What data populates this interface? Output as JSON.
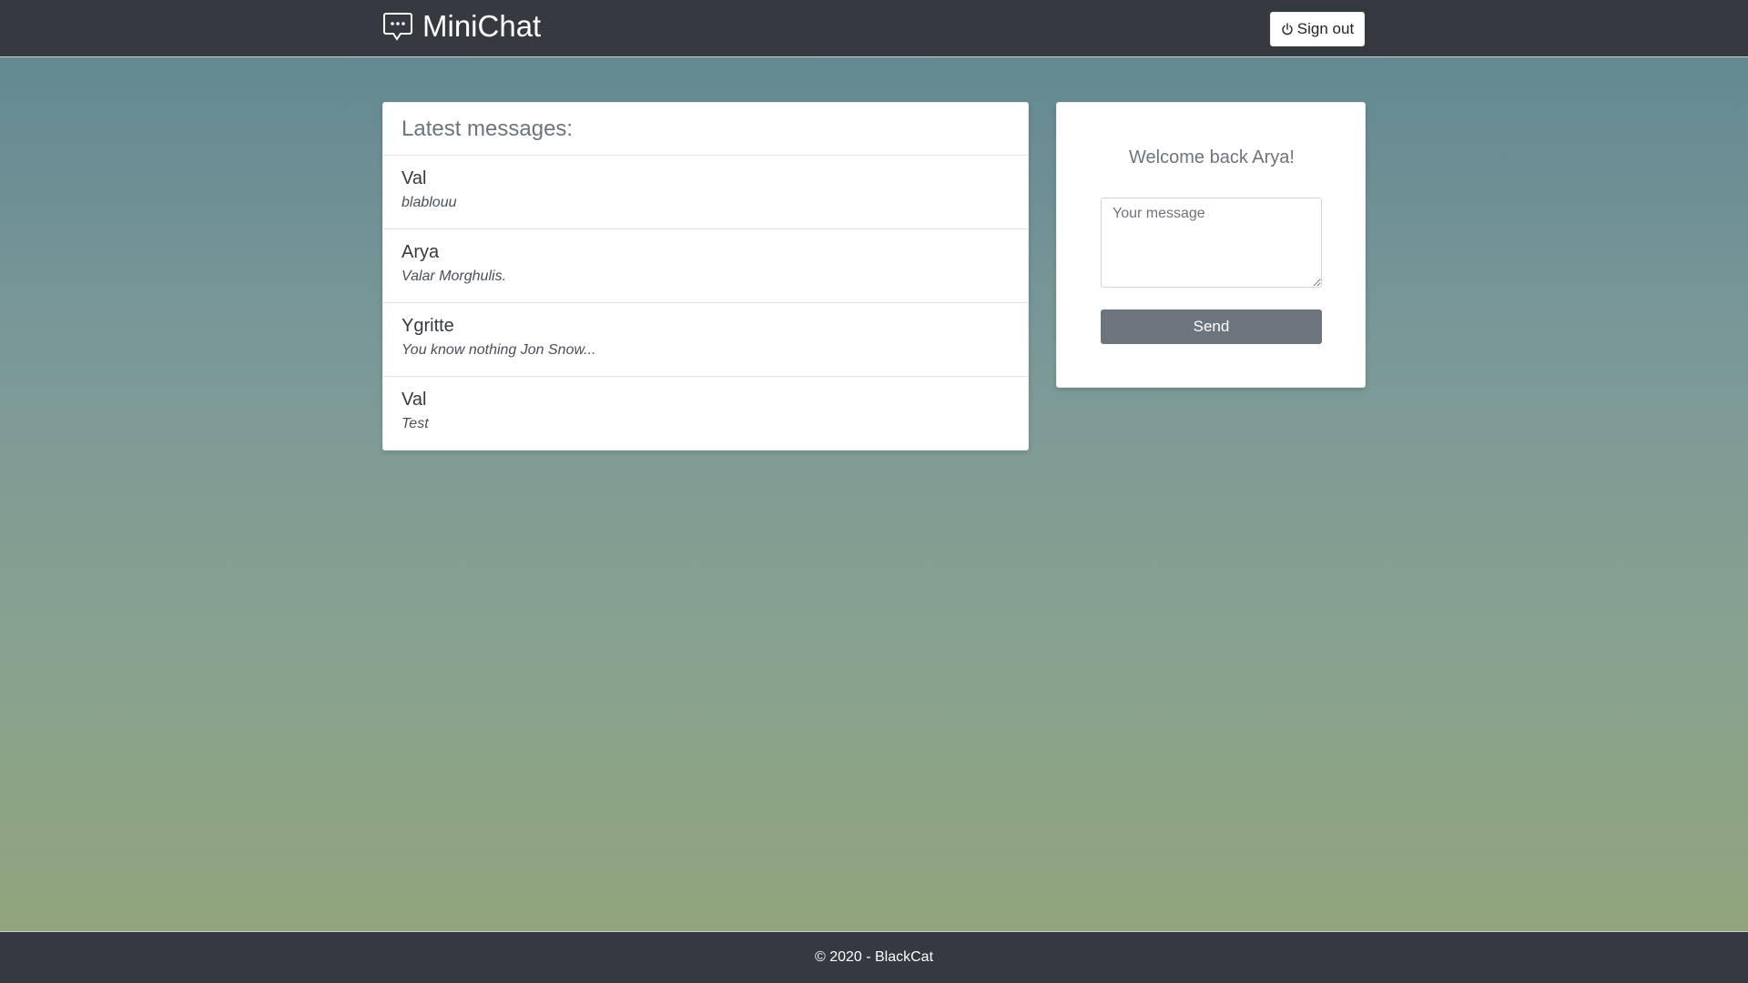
{
  "app": {
    "name": "MiniChat",
    "logo_icon": "chat-bubble-icon"
  },
  "header": {
    "sign_out_label": "Sign out",
    "sign_out_icon": "power-icon"
  },
  "messages": {
    "heading": "Latest messages:",
    "items": [
      {
        "author": "Val",
        "text": "blablouu"
      },
      {
        "author": "Arya",
        "text": "Valar Morghulis."
      },
      {
        "author": "Ygritte",
        "text": "You know nothing Jon Snow..."
      },
      {
        "author": "Val",
        "text": "Test"
      }
    ]
  },
  "compose": {
    "welcome": "Welcome back Arya!",
    "placeholder": "Your message",
    "value": "",
    "send_label": "Send"
  },
  "footer": {
    "text": "© 2020 - BlackCat"
  },
  "colors": {
    "navbar": "#343a40",
    "send_button": "#6c757d"
  }
}
